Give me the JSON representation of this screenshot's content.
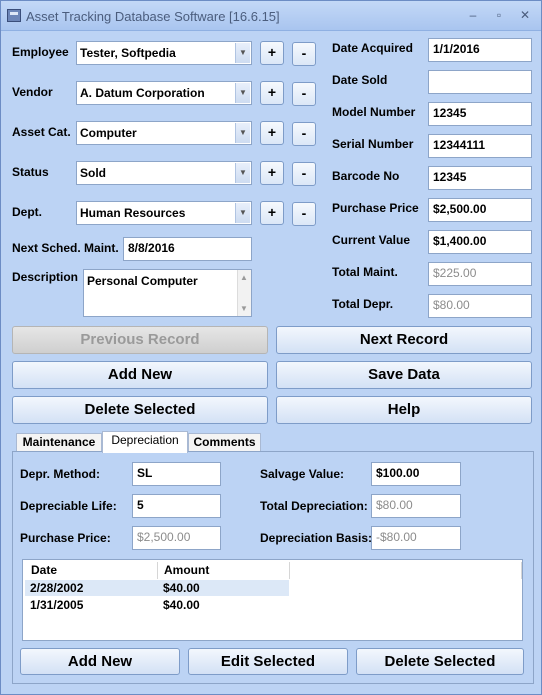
{
  "window": {
    "title": "Asset Tracking Database Software [16.6.15]"
  },
  "left_fields": {
    "employee": {
      "label": "Employee",
      "value": "Tester, Softpedia"
    },
    "vendor": {
      "label": "Vendor",
      "value": "A. Datum Corporation"
    },
    "asset_cat": {
      "label": "Asset Cat.",
      "value": "Computer"
    },
    "status": {
      "label": "Status",
      "value": "Sold"
    },
    "dept": {
      "label": "Dept.",
      "value": "Human Resources"
    },
    "next_maint": {
      "label": "Next Sched. Maint.",
      "value": "8/8/2016"
    },
    "description": {
      "label": "Description",
      "value": "Personal Computer"
    }
  },
  "plus_symbol": "+",
  "minus_symbol": "-",
  "right_fields": {
    "date_acquired": {
      "label": "Date Acquired",
      "value": "1/1/2016"
    },
    "date_sold": {
      "label": "Date Sold",
      "value": ""
    },
    "model_number": {
      "label": "Model Number",
      "value": "12345"
    },
    "serial_number": {
      "label": "Serial Number",
      "value": "12344111"
    },
    "barcode_no": {
      "label": "Barcode No",
      "value": "12345"
    },
    "purchase_price": {
      "label": "Purchase Price",
      "value": "$2,500.00"
    },
    "current_value": {
      "label": "Current Value",
      "value": "$1,400.00"
    },
    "total_maint": {
      "label": "Total Maint.",
      "value": "$225.00"
    },
    "total_depr": {
      "label": "Total Depr.",
      "value": "$80.00"
    }
  },
  "buttons": {
    "previous_record": "Previous Record",
    "next_record": "Next Record",
    "add_new": "Add New",
    "save_data": "Save Data",
    "delete_selected": "Delete Selected",
    "help": "Help"
  },
  "tabs": {
    "maintenance": "Maintenance",
    "depreciation": "Depreciation",
    "comments": "Comments"
  },
  "depreciation": {
    "method": {
      "label": "Depr. Method:",
      "value": "SL"
    },
    "life": {
      "label": "Depreciable Life:",
      "value": "5"
    },
    "purchase_price": {
      "label": "Purchase Price:",
      "value": "$2,500.00"
    },
    "salvage_value": {
      "label": "Salvage Value:",
      "value": "$100.00"
    },
    "total_depreciation": {
      "label": "Total Depreciation:",
      "value": "$80.00"
    },
    "basis": {
      "label": "Depreciation Basis:",
      "value": "-$80.00"
    },
    "list": {
      "columns": [
        "Date",
        "Amount"
      ],
      "rows": [
        {
          "date": "2/28/2002",
          "amount": "$40.00"
        },
        {
          "date": "1/31/2005",
          "amount": "$40.00"
        }
      ]
    },
    "buttons": {
      "add_new": "Add New",
      "edit_selected": "Edit Selected",
      "delete_selected": "Delete Selected"
    }
  },
  "window_controls": {
    "close": "✕",
    "minimize": "–",
    "maximize": "▫"
  }
}
